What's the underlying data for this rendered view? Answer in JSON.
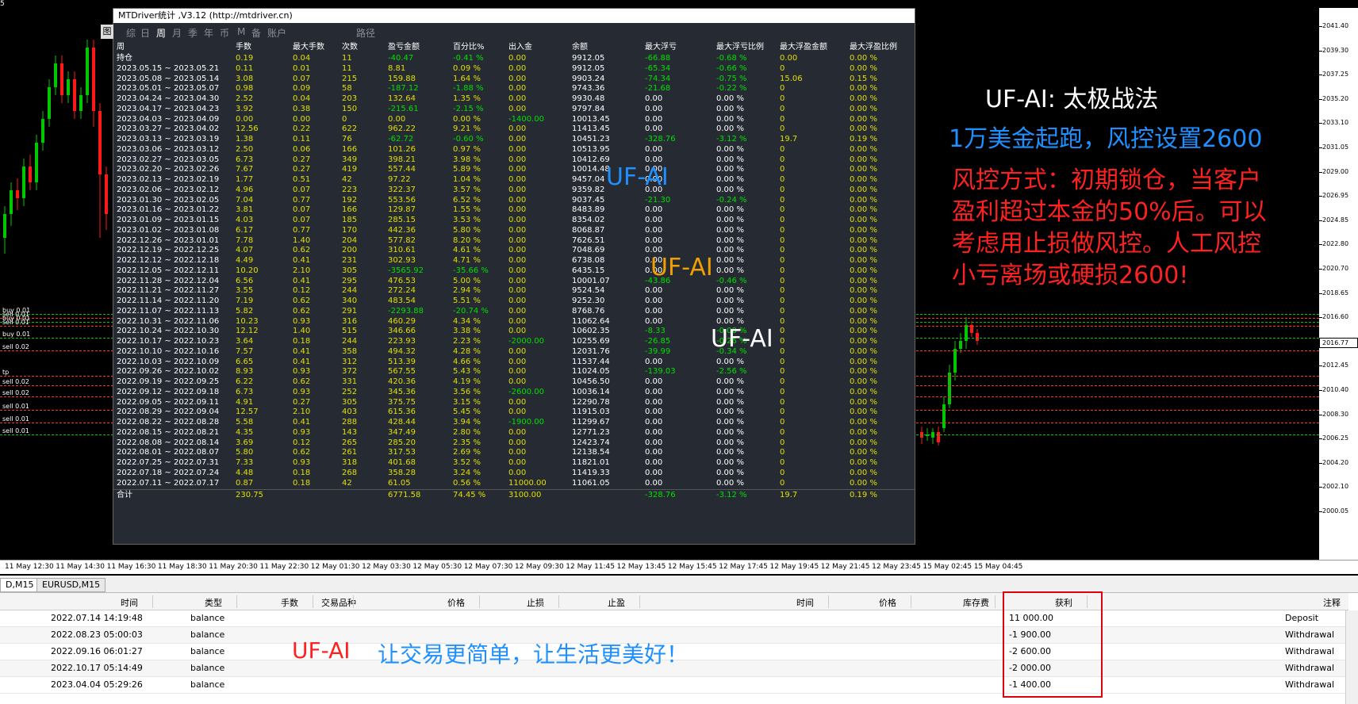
{
  "window": {
    "corner_label": "5"
  },
  "panel": {
    "title": "MTDriver统计 ,V3.12 (http://mtdriver.cn)",
    "side_tab": "图",
    "tabs": [
      "综",
      "日",
      "周",
      "月",
      "季",
      "年",
      "币",
      "M",
      "备",
      "账户",
      "路径"
    ],
    "active_tab": "周",
    "columns": [
      "周",
      "手数",
      "最大手数",
      "次数",
      "盈亏金额",
      "百分比%",
      "出入金",
      "余额",
      "最大浮亏",
      "最大浮亏比例",
      "最大浮盈金额",
      "最大浮盈比例"
    ],
    "rows": [
      [
        "持仓",
        "0.19",
        "0.04",
        "11",
        "-40.47",
        "-0.41 %",
        "0.00",
        "9912.05",
        "-66.88",
        "-0.68 %",
        "0.00",
        "0.00 %"
      ],
      [
        "2023.05.15 ~ 2023.05.21",
        "0.11",
        "0.01",
        "11",
        "8.81",
        "0.09 %",
        "0.00",
        "9912.05",
        "-65.34",
        "-0.66 %",
        "0",
        "0.00 %"
      ],
      [
        "2023.05.08 ~ 2023.05.14",
        "3.08",
        "0.07",
        "215",
        "159.88",
        "1.64 %",
        "0.00",
        "9903.24",
        "-74.34",
        "-0.75 %",
        "15.06",
        "0.15 %"
      ],
      [
        "2023.05.01 ~ 2023.05.07",
        "0.98",
        "0.09",
        "58",
        "-187.12",
        "-1.88 %",
        "0.00",
        "9743.36",
        "-21.68",
        "-0.22 %",
        "0",
        "0.00 %"
      ],
      [
        "2023.04.24 ~ 2023.04.30",
        "2.52",
        "0.04",
        "203",
        "132.64",
        "1.35 %",
        "0.00",
        "9930.48",
        "0.00",
        "0.00 %",
        "0",
        "0.00 %"
      ],
      [
        "2023.04.17 ~ 2023.04.23",
        "3.92",
        "0.38",
        "150",
        "-215.61",
        "-2.15 %",
        "0.00",
        "9797.84",
        "0.00",
        "0.00 %",
        "0",
        "0.00 %"
      ],
      [
        "2023.04.03 ~ 2023.04.09",
        "0.00",
        "0.00",
        "0",
        "0.00",
        "0.00 %",
        "-1400.00",
        "10013.45",
        "0.00",
        "0.00 %",
        "0",
        "0.00 %"
      ],
      [
        "2023.03.27 ~ 2023.04.02",
        "12.56",
        "0.22",
        "622",
        "962.22",
        "9.21 %",
        "0.00",
        "11413.45",
        "0.00",
        "0.00 %",
        "0",
        "0.00 %"
      ],
      [
        "2023.03.13 ~ 2023.03.19",
        "1.38",
        "0.11",
        "76",
        "-62.72",
        "-0.60 %",
        "0.00",
        "10451.23",
        "-328.76",
        "-3.12 %",
        "19.7",
        "0.19 %"
      ],
      [
        "2023.03.06 ~ 2023.03.12",
        "2.50",
        "0.06",
        "166",
        "101.26",
        "0.97 %",
        "0.00",
        "10513.95",
        "0.00",
        "0.00 %",
        "0",
        "0.00 %"
      ],
      [
        "2023.02.27 ~ 2023.03.05",
        "6.73",
        "0.27",
        "349",
        "398.21",
        "3.98 %",
        "0.00",
        "10412.69",
        "0.00",
        "0.00 %",
        "0",
        "0.00 %"
      ],
      [
        "2023.02.20 ~ 2023.02.26",
        "7.67",
        "0.27",
        "419",
        "557.44",
        "5.89 %",
        "0.00",
        "10014.48",
        "0.00",
        "0.00 %",
        "0",
        "0.00 %"
      ],
      [
        "2023.02.13 ~ 2023.02.19",
        "1.77",
        "0.51",
        "42",
        "97.22",
        "1.04 %",
        "0.00",
        "9457.04",
        "0.00",
        "0.00 %",
        "0",
        "0.00 %"
      ],
      [
        "2023.02.06 ~ 2023.02.12",
        "4.96",
        "0.07",
        "223",
        "322.37",
        "3.57 %",
        "0.00",
        "9359.82",
        "0.00",
        "0.00 %",
        "0",
        "0.00 %"
      ],
      [
        "2023.01.30 ~ 2023.02.05",
        "7.04",
        "0.77",
        "192",
        "553.56",
        "6.52 %",
        "0.00",
        "9037.45",
        "-21.30",
        "-0.24 %",
        "0",
        "0.00 %"
      ],
      [
        "2023.01.16 ~ 2023.01.22",
        "3.81",
        "0.07",
        "166",
        "129.87",
        "1.55 %",
        "0.00",
        "8483.89",
        "0.00",
        "0.00 %",
        "0",
        "0.00 %"
      ],
      [
        "2023.01.09 ~ 2023.01.15",
        "4.03",
        "0.07",
        "185",
        "285.15",
        "3.53 %",
        "0.00",
        "8354.02",
        "0.00",
        "0.00 %",
        "0",
        "0.00 %"
      ],
      [
        "2023.01.02 ~ 2023.01.08",
        "6.17",
        "0.77",
        "170",
        "442.36",
        "5.80 %",
        "0.00",
        "8068.87",
        "0.00",
        "0.00 %",
        "0",
        "0.00 %"
      ],
      [
        "2022.12.26 ~ 2023.01.01",
        "7.78",
        "1.40",
        "204",
        "577.82",
        "8.20 %",
        "0.00",
        "7626.51",
        "0.00",
        "0.00 %",
        "0",
        "0.00 %"
      ],
      [
        "2022.12.19 ~ 2022.12.25",
        "4.07",
        "0.62",
        "200",
        "310.61",
        "4.61 %",
        "0.00",
        "7048.69",
        "0.00",
        "0.00 %",
        "0",
        "0.00 %"
      ],
      [
        "2022.12.12 ~ 2022.12.18",
        "4.49",
        "0.41",
        "231",
        "302.93",
        "4.71 %",
        "0.00",
        "6738.08",
        "0.00",
        "0.00 %",
        "0",
        "0.00 %"
      ],
      [
        "2022.12.05 ~ 2022.12.11",
        "10.20",
        "2.10",
        "305",
        "-3565.92",
        "-35.66 %",
        "0.00",
        "6435.15",
        "0.00",
        "0.00 %",
        "0",
        "0.00 %"
      ],
      [
        "2022.11.28 ~ 2022.12.04",
        "6.56",
        "0.41",
        "295",
        "476.53",
        "5.00 %",
        "0.00",
        "10001.07",
        "-43.86",
        "-0.46 %",
        "0",
        "0.00 %"
      ],
      [
        "2022.11.21 ~ 2022.11.27",
        "3.55",
        "0.12",
        "244",
        "272.24",
        "2.94 %",
        "0.00",
        "9524.54",
        "0.00",
        "0.00 %",
        "0",
        "0.00 %"
      ],
      [
        "2022.11.14 ~ 2022.11.20",
        "7.19",
        "0.62",
        "340",
        "483.54",
        "5.51 %",
        "0.00",
        "9252.30",
        "0.00",
        "0.00 %",
        "0",
        "0.00 %"
      ],
      [
        "2022.11.07 ~ 2022.11.13",
        "5.82",
        "0.62",
        "291",
        "-2293.88",
        "-20.74 %",
        "0.00",
        "8768.76",
        "0.00",
        "0.00 %",
        "0",
        "0.00 %"
      ],
      [
        "2022.10.31 ~ 2022.11.06",
        "10.23",
        "0.93",
        "316",
        "460.29",
        "4.34 %",
        "0.00",
        "11062.64",
        "0.00",
        "0.00 %",
        "0",
        "0.00 %"
      ],
      [
        "2022.10.24 ~ 2022.10.30",
        "12.12",
        "1.40",
        "515",
        "346.66",
        "3.38 %",
        "0.00",
        "10602.35",
        "-8.33",
        "-0.08 %",
        "0",
        "0.00 %"
      ],
      [
        "2022.10.17 ~ 2022.10.23",
        "3.64",
        "0.18",
        "244",
        "223.93",
        "2.23 %",
        "-2000.00",
        "10255.69",
        "-26.85",
        "-0.26 %",
        "0",
        "0.00 %"
      ],
      [
        "2022.10.10 ~ 2022.10.16",
        "7.57",
        "0.41",
        "358",
        "494.32",
        "4.28 %",
        "0.00",
        "12031.76",
        "-39.99",
        "-0.34 %",
        "0",
        "0.00 %"
      ],
      [
        "2022.10.03 ~ 2022.10.09",
        "6.65",
        "0.41",
        "312",
        "513.39",
        "4.66 %",
        "0.00",
        "11537.44",
        "0.00",
        "0.00 %",
        "0",
        "0.00 %"
      ],
      [
        "2022.09.26 ~ 2022.10.02",
        "8.93",
        "0.93",
        "372",
        "567.55",
        "5.43 %",
        "0.00",
        "11024.05",
        "-139.03",
        "-2.56 %",
        "0",
        "0.00 %"
      ],
      [
        "2022.09.19 ~ 2022.09.25",
        "6.22",
        "0.62",
        "331",
        "420.36",
        "4.19 %",
        "0.00",
        "10456.50",
        "0.00",
        "0.00 %",
        "0",
        "0.00 %"
      ],
      [
        "2022.09.12 ~ 2022.09.18",
        "6.73",
        "0.93",
        "252",
        "345.36",
        "3.56 %",
        "-2600.00",
        "10036.14",
        "0.00",
        "0.00 %",
        "0",
        "0.00 %"
      ],
      [
        "2022.09.05 ~ 2022.09.11",
        "4.91",
        "0.27",
        "305",
        "375.75",
        "3.15 %",
        "0.00",
        "12290.78",
        "0.00",
        "0.00 %",
        "0",
        "0.00 %"
      ],
      [
        "2022.08.29 ~ 2022.09.04",
        "12.57",
        "2.10",
        "403",
        "615.36",
        "5.45 %",
        "0.00",
        "11915.03",
        "0.00",
        "0.00 %",
        "0",
        "0.00 %"
      ],
      [
        "2022.08.22 ~ 2022.08.28",
        "5.58",
        "0.41",
        "288",
        "428.44",
        "3.94 %",
        "-1900.00",
        "11299.67",
        "0.00",
        "0.00 %",
        "0",
        "0.00 %"
      ],
      [
        "2022.08.15 ~ 2022.08.21",
        "4.35",
        "0.93",
        "143",
        "347.49",
        "2.80 %",
        "0.00",
        "12771.23",
        "0.00",
        "0.00 %",
        "0",
        "0.00 %"
      ],
      [
        "2022.08.08 ~ 2022.08.14",
        "3.69",
        "0.12",
        "265",
        "285.20",
        "2.35 %",
        "0.00",
        "12423.74",
        "0.00",
        "0.00 %",
        "0",
        "0.00 %"
      ],
      [
        "2022.08.01 ~ 2022.08.07",
        "5.80",
        "0.62",
        "261",
        "317.53",
        "2.69 %",
        "0.00",
        "12138.54",
        "0.00",
        "0.00 %",
        "0",
        "0.00 %"
      ],
      [
        "2022.07.25 ~ 2022.07.31",
        "7.33",
        "0.93",
        "318",
        "401.68",
        "3.52 %",
        "0.00",
        "11821.01",
        "0.00",
        "0.00 %",
        "0",
        "0.00 %"
      ],
      [
        "2022.07.18 ~ 2022.07.24",
        "4.48",
        "0.18",
        "268",
        "358.28",
        "3.24 %",
        "0.00",
        "11419.33",
        "0.00",
        "0.00 %",
        "0",
        "0.00 %"
      ],
      [
        "2022.07.11 ~ 2022.07.17",
        "0.87",
        "0.18",
        "42",
        "61.05",
        "0.56 %",
        "11000.00",
        "11061.05",
        "0.00",
        "0.00 %",
        "0",
        "0.00 %"
      ]
    ],
    "summary": [
      "合计",
      "230.75",
      "",
      "",
      "6771.58",
      "74.45 %",
      "3100.00",
      "",
      "-328.76",
      "-3.12 %",
      "19.7",
      "0.19 %"
    ]
  },
  "chart": {
    "price_labels": [
      "2041.40",
      "2039.30",
      "2037.25",
      "2035.20",
      "2033.10",
      "2031.05",
      "2029.00",
      "2026.95",
      "2024.85",
      "2022.80",
      "2020.70",
      "2018.65",
      "2016.60",
      "2014.50",
      "2012.45",
      "2010.40",
      "2008.30",
      "2006.25",
      "2004.20",
      "2002.10",
      "2000.05"
    ],
    "current_price": "2016.77",
    "time_labels": [
      "11 May 12:30",
      "11 May 14:30",
      "11 May 16:30",
      "11 May 18:30",
      "11 May 20:30",
      "11 May 22:30",
      "12 May 01:30",
      "12 May 03:30",
      "12 May 05:30",
      "12 May 07:30",
      "12 May 09:30",
      "12 May 11:45",
      "12 May 13:45",
      "12 May 15:45",
      "12 May 17:45",
      "12 May 19:45",
      "12 May 21:45",
      "12 May 23:45",
      "15 May 02:45",
      "15 May 04:45"
    ],
    "order_labels": [
      "buy 0.01",
      "sell 0.01",
      "buy 0.01",
      "sell 0.01",
      "buy 0.01",
      "sell 0.02",
      "tp",
      "sell 0.02",
      "sell 0.02",
      "sell 0.01",
      "sell 0.01",
      "sell 0.01"
    ]
  },
  "overlay": {
    "title": "UF-AI:   太极战法",
    "subtitle": "1万美金起跑，风控设置2600",
    "risk_text": [
      "风控方式：初期锁仓，当客户",
      "盈利超过本金的50%后。可以",
      "考虑用止损做风控。人工风控",
      "小亏离场或硬损2600!"
    ],
    "watermark": "UF-AI",
    "slogan_brand": "UF-AI",
    "slogan_text": "让交易更简单，让生活更美好！"
  },
  "terminal": {
    "tabs": [
      "D,M15",
      "EURUSD,M15"
    ],
    "active_tab": "D,M15",
    "columns": [
      "时间",
      "类型",
      "手数",
      "交易品种",
      "价格",
      "止损",
      "止盈",
      "时间",
      "价格",
      "库存费",
      "获利",
      "注释"
    ],
    "rows": [
      [
        "2022.07.14 14:19:48",
        "balance",
        "11 000.00",
        "Deposit"
      ],
      [
        "2022.08.23 05:00:03",
        "balance",
        "-1 900.00",
        "Withdrawal"
      ],
      [
        "2022.09.16 06:01:27",
        "balance",
        "-2 600.00",
        "Withdrawal"
      ],
      [
        "2022.10.17 05:14:49",
        "balance",
        "-2 000.00",
        "Withdrawal"
      ],
      [
        "2023.04.04 05:29:26",
        "balance",
        "-1 400.00",
        "Withdrawal"
      ]
    ]
  },
  "colors": {
    "up": "#00c800",
    "down": "#ff1a1a",
    "panel_bg": "#252a33",
    "yellow": "#e0e000",
    "green": "#00e000",
    "accent_blue": "#1e90ff",
    "red": "#ff2020"
  }
}
